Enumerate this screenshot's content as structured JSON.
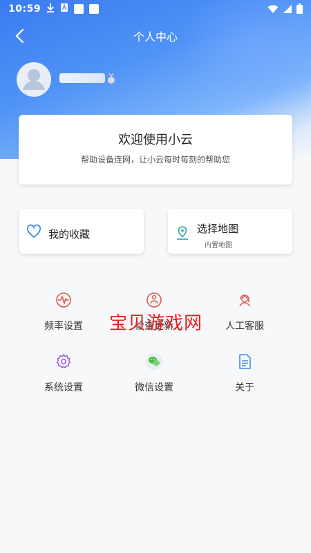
{
  "status_bar": {
    "time": "10:59"
  },
  "header": {
    "title": "个人中心"
  },
  "welcome": {
    "title": "欢迎使用小云",
    "subtitle": "帮助设备连网，让小云每时每刻的帮助您"
  },
  "cards": [
    {
      "label": "我的收藏",
      "sub": ""
    },
    {
      "label": "选择地图",
      "sub": "内置地图"
    }
  ],
  "menu": [
    {
      "label": "频率设置",
      "icon": "waveform-icon"
    },
    {
      "label": "检查更新",
      "icon": "update-icon"
    },
    {
      "label": "人工客服",
      "icon": "customer-service-icon"
    },
    {
      "label": "系统设置",
      "icon": "gear-icon"
    },
    {
      "label": "微信设置",
      "icon": "wechat-icon"
    },
    {
      "label": "关于",
      "icon": "document-icon"
    }
  ],
  "watermark": "宝贝游戏网",
  "colors": {
    "accent": "#3a7bf0",
    "icon_red": "#e2574c",
    "icon_purple": "#9b59d0",
    "icon_blue": "#3a8ee6",
    "icon_teal": "#2aa6a0"
  }
}
